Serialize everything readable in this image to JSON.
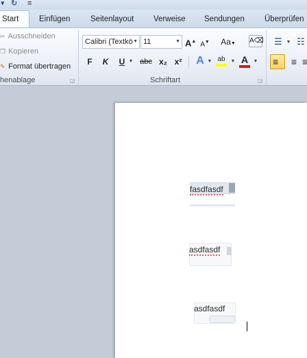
{
  "tabs": [
    {
      "label": "Start",
      "active": true
    },
    {
      "label": "Einfügen"
    },
    {
      "label": "Seitenlayout"
    },
    {
      "label": "Verweise"
    },
    {
      "label": "Sendungen"
    },
    {
      "label": "Überprüfen"
    }
  ],
  "clipboard": {
    "cut_label": "Ausschneiden",
    "copy_label": "Kopieren",
    "format_painter_label": "Format übertragen",
    "group_label": "henablage"
  },
  "font": {
    "font_name": "Calibri (Textkö",
    "font_size": "11",
    "grow_font": "A",
    "shrink_font": "A",
    "change_case": "Aa",
    "bold": "F",
    "italic": "K",
    "underline": "U",
    "strikethrough": "abc",
    "subscript": "x₂",
    "superscript": "x²",
    "text_effects": "A",
    "highlight": "ab",
    "font_color": "A",
    "group_label": "Schriftart",
    "highlight_color": "#ffff00",
    "font_color_value": "#e0141e"
  },
  "document": {
    "text_boxes": [
      {
        "text": "fasdfasdf"
      },
      {
        "text": "asdfasdf"
      },
      {
        "text": "asdfasdf"
      }
    ]
  },
  "icons": {
    "cut": "scissors-icon",
    "copy": "copy-icon",
    "format_painter": "brush-icon",
    "bullets": "bullet-list-icon",
    "numbering": "numbered-list-icon",
    "align_left": "align-left-icon",
    "center": "align-center-icon"
  }
}
